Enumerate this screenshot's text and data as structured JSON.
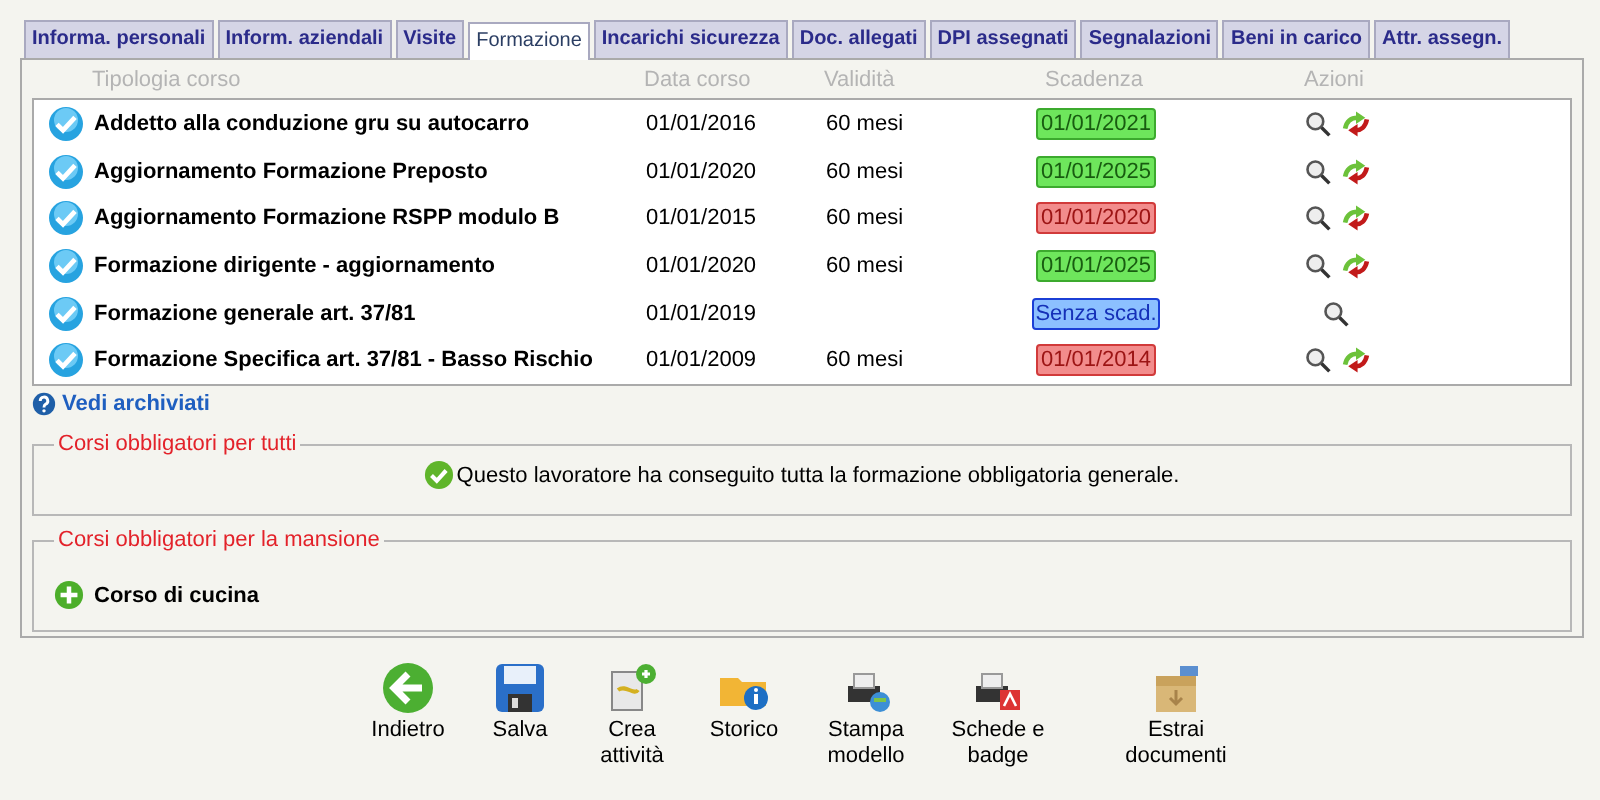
{
  "tabs": [
    {
      "label": "Informa. personali",
      "selected": false
    },
    {
      "label": "Inform. aziendali",
      "selected": false
    },
    {
      "label": "Visite",
      "selected": false
    },
    {
      "label": "Formazione",
      "selected": true
    },
    {
      "label": "Incarichi sicurezza",
      "selected": false
    },
    {
      "label": "Doc. allegati",
      "selected": false
    },
    {
      "label": "DPI assegnati",
      "selected": false
    },
    {
      "label": "Segnalazioni",
      "selected": false
    },
    {
      "label": "Beni in carico",
      "selected": false
    },
    {
      "label": "Attr. assegn.",
      "selected": false
    }
  ],
  "table": {
    "columns": [
      "Tipologia corso",
      "Data corso",
      "Validità",
      "Scadenza",
      "Azioni"
    ],
    "rows": [
      {
        "course": "Addetto alla conduzione gru su autocarro",
        "date": "01/01/2016",
        "validity": "60 mesi",
        "expiry": {
          "text": "01/01/2021",
          "kind": "valid"
        },
        "renewable": true
      },
      {
        "course": "Aggiornamento Formazione Preposto",
        "date": "01/01/2020",
        "validity": "60 mesi",
        "expiry": {
          "text": "01/01/2025",
          "kind": "valid"
        },
        "renewable": true
      },
      {
        "course": "Aggiornamento Formazione RSPP modulo B",
        "date": "01/01/2015",
        "validity": "60 mesi",
        "expiry": {
          "text": "01/01/2020",
          "kind": "expired"
        },
        "renewable": true
      },
      {
        "course": "Formazione dirigente - aggiornamento",
        "date": "01/01/2020",
        "validity": "60 mesi",
        "expiry": {
          "text": "01/01/2025",
          "kind": "valid"
        },
        "renewable": true
      },
      {
        "course": "Formazione generale art. 37/81",
        "date": "01/01/2019",
        "expiry": {
          "text": "Senza scad.",
          "kind": "none"
        },
        "renewable": false
      },
      {
        "course": "Formazione Specifica art. 37/81 - Basso Rischio",
        "date": "01/01/2009",
        "validity": "60 mesi",
        "expiry": {
          "text": "01/01/2014",
          "kind": "expired"
        },
        "renewable": true
      }
    ]
  },
  "archive_link": "Vedi archiviati",
  "general_section": {
    "legend": "Corsi obbligatori per tutti",
    "message": "Questo lavoratore ha conseguito tutta la formazione obbligatoria generale."
  },
  "role_section": {
    "legend": "Corsi obbligatori per la mansione",
    "items": [
      "Corso di cucina"
    ]
  },
  "toolbar": [
    {
      "label": "Indietro",
      "kind": "back"
    },
    {
      "label": "Salva",
      "kind": "save"
    },
    {
      "label": "Crea attività",
      "kind": "create"
    },
    {
      "label": "Storico",
      "kind": "history"
    },
    {
      "label": "Stampa modello",
      "kind": "print"
    },
    {
      "label": "Schede e badge",
      "kind": "pdf"
    },
    {
      "label": "Estrai documenti",
      "kind": "extract"
    }
  ]
}
